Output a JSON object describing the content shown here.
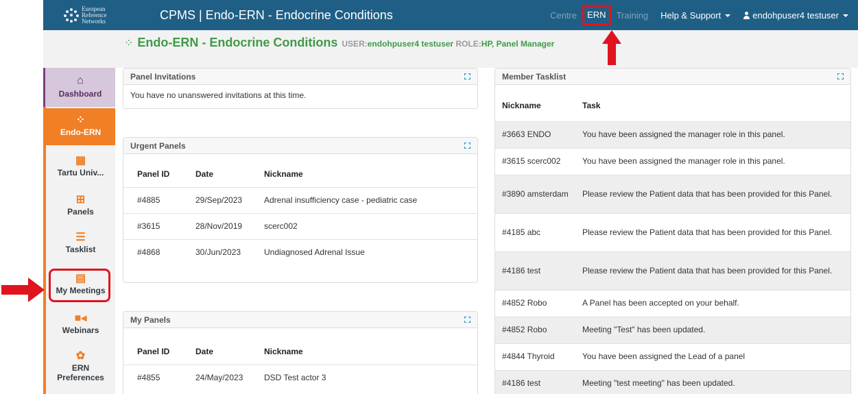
{
  "header": {
    "logo_lines": [
      "European",
      "Reference",
      "Networks"
    ],
    "app_title": "CPMS | Endo-ERN - Endocrine Conditions",
    "nav": {
      "centre": "Centre",
      "ern": "ERN",
      "training": "Training",
      "help": "Help & Support",
      "user": "endohpuser4 testuser"
    }
  },
  "page": {
    "title": "Endo-ERN - Endocrine Conditions",
    "user_label": "USER:",
    "user_value": "endohpuser4 testuser",
    "role_label": "ROLE:",
    "role_value": "HP, Panel Manager"
  },
  "sidebar": {
    "items": [
      {
        "label": "Dashboard",
        "icon": "home-icon"
      },
      {
        "label": "Endo-ERN",
        "icon": "network-icon"
      },
      {
        "label": "Tartu Univ...",
        "icon": "hospital-icon"
      },
      {
        "label": "Panels",
        "icon": "clipboard-plus-icon"
      },
      {
        "label": "Tasklist",
        "icon": "tasklist-icon"
      },
      {
        "label": "My Meetings",
        "icon": "calendar-icon"
      },
      {
        "label": "Webinars",
        "icon": "video-camera-icon"
      },
      {
        "label": "ERN",
        "icon": "gear-icon"
      },
      {
        "label": "Preferences",
        "icon": ""
      }
    ]
  },
  "panel_invitations": {
    "title": "Panel Invitations",
    "message": "You have no unanswered invitations at this time."
  },
  "urgent_panels": {
    "title": "Urgent Panels",
    "columns": [
      "Panel ID",
      "Date",
      "Nickname"
    ],
    "rows": [
      {
        "id": "#4885",
        "date": "29/Sep/2023",
        "nickname": "Adrenal insufficiency case - pediatric case"
      },
      {
        "id": "#3615",
        "date": "28/Nov/2019",
        "nickname": "scerc002"
      },
      {
        "id": "#4868",
        "date": "30/Jun/2023",
        "nickname": "Undiagnosed Adrenal Issue"
      }
    ]
  },
  "my_panels": {
    "title": "My Panels",
    "columns": [
      "Panel ID",
      "Date",
      "Nickname"
    ],
    "rows": [
      {
        "id": "#4855",
        "date": "24/May/2023",
        "nickname": "DSD Test actor 3"
      }
    ]
  },
  "member_tasklist": {
    "title": "Member Tasklist",
    "columns": [
      "Nickname",
      "Task"
    ],
    "rows": [
      {
        "nickname": "#3663 ENDO",
        "task": "You have been assigned the manager role in this panel."
      },
      {
        "nickname": "#3615 scerc002",
        "task": "You have been assigned the manager role in this panel."
      },
      {
        "nickname": "#3890 amsterdam",
        "task": "Please review the Patient data that has been provided for this Panel."
      },
      {
        "nickname": "#4185 abc",
        "task": "Please review the Patient data that has been provided for this Panel."
      },
      {
        "nickname": "#4186 test",
        "task": "Please review the Patient data that has been provided for this Panel."
      },
      {
        "nickname": "#4852 Robo",
        "task": "A Panel has been accepted on your behalf."
      },
      {
        "nickname": "#4852 Robo",
        "task": "Meeting \"Test\" has been updated."
      },
      {
        "nickname": "#4844 Thyroid",
        "task": "You have been assigned the Lead of a panel"
      },
      {
        "nickname": "#4186 test",
        "task": "Meeting \"test meeting\" has been updated."
      }
    ]
  },
  "colors": {
    "navbar": "#1f5f85",
    "accent_orange": "#f07f26",
    "title_green": "#3f9a48",
    "highlight_red": "#e0141e",
    "dashboard_purple": "#7b3f7f"
  }
}
